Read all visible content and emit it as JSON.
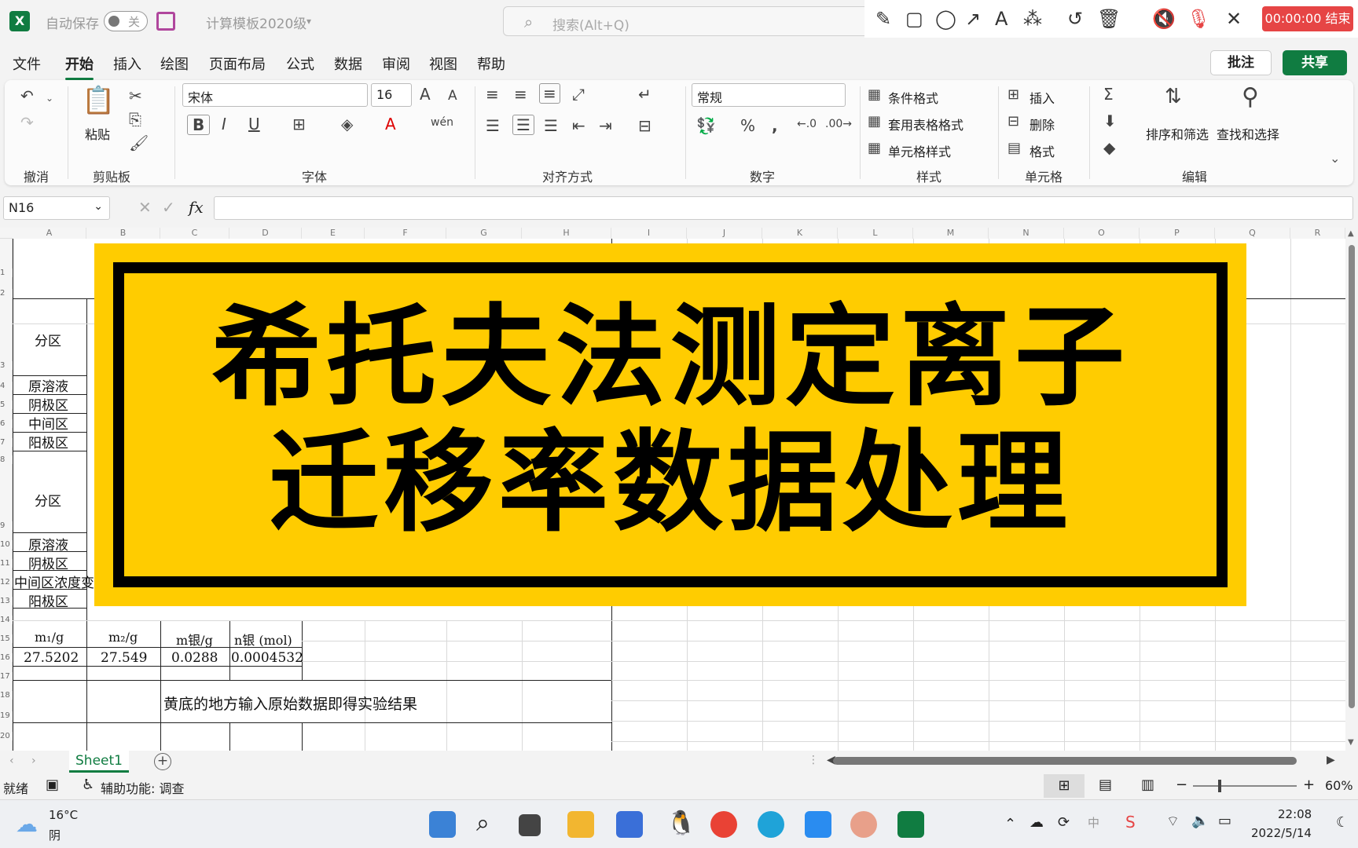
{
  "titlebar": {
    "autosave_label": "自动保存",
    "autosave_state": "关",
    "doc_title": "计算模板2020级",
    "search_placeholder": "搜索(Alt+Q)",
    "record_label": "00:00:00 结束"
  },
  "menu": {
    "tabs": [
      "文件",
      "开始",
      "插入",
      "绘图",
      "页面布局",
      "公式",
      "数据",
      "审阅",
      "视图",
      "帮助"
    ],
    "active": "开始",
    "comments_label": "批注",
    "share_label": "共享"
  },
  "ribbon": {
    "groups": {
      "undo": "撤消",
      "clipboard": "剪贴板",
      "font": "字体",
      "alignment": "对齐方式",
      "number": "数字",
      "styles": "样式",
      "cells": "单元格",
      "editing": "编辑"
    },
    "paste_label": "粘贴",
    "font_name": "宋体",
    "font_size": "16",
    "number_format": "常规",
    "cond_format": "条件格式",
    "table_format": "套用表格格式",
    "cell_styles": "单元格样式",
    "insert": "插入",
    "delete": "删除",
    "format": "格式",
    "sort_filter": "排序和筛选",
    "find_select": "查找和选择"
  },
  "formula_bar": {
    "name_box": "N16",
    "fx": "fx",
    "value": ""
  },
  "grid": {
    "columns": [
      "A",
      "B",
      "C",
      "D",
      "E",
      "F",
      "G",
      "H",
      "I",
      "J",
      "K",
      "L",
      "M",
      "N",
      "O",
      "P",
      "Q",
      "R"
    ],
    "rows": [
      "1",
      "2",
      "3",
      "4",
      "5",
      "6",
      "7",
      "8",
      "9",
      "10",
      "11",
      "12",
      "13",
      "14",
      "15",
      "16",
      "17",
      "18",
      "19",
      "20"
    ],
    "cells": {
      "a3": "分区",
      "a4": "原溶液",
      "a5": "阴极区",
      "a6": "中间区",
      "a7": "阳极区",
      "a9": "分区",
      "a10": "原溶液",
      "a11": "阴极区",
      "a12": "中间区浓度变",
      "a13": "阳极区",
      "a15": "m₁/g",
      "b15": "m₂/g",
      "c15": "m银/g",
      "d15": "n银 (mol)",
      "a16": "27.5202",
      "b16": "27.549",
      "c16": "0.0288",
      "d16": "0.0004532",
      "note": "黄底的地方输入原始数据即得实验结果"
    }
  },
  "banner": {
    "line1": "希托夫法测定离子",
    "line2": "迁移率数据处理"
  },
  "sheets": {
    "tabs": [
      "Sheet1"
    ],
    "active": "Sheet1"
  },
  "statusbar": {
    "ready": "就绪",
    "accessibility": "辅助功能: 调查",
    "zoom": "60%"
  },
  "taskbar": {
    "weather_temp": "16°C",
    "weather_desc": "阴",
    "time": "22:08",
    "date": "2022/5/14",
    "ime": "中"
  },
  "colors": {
    "accent": "#107c41",
    "banner_bg": "#ffcc00",
    "record_bg": "#e64545"
  }
}
